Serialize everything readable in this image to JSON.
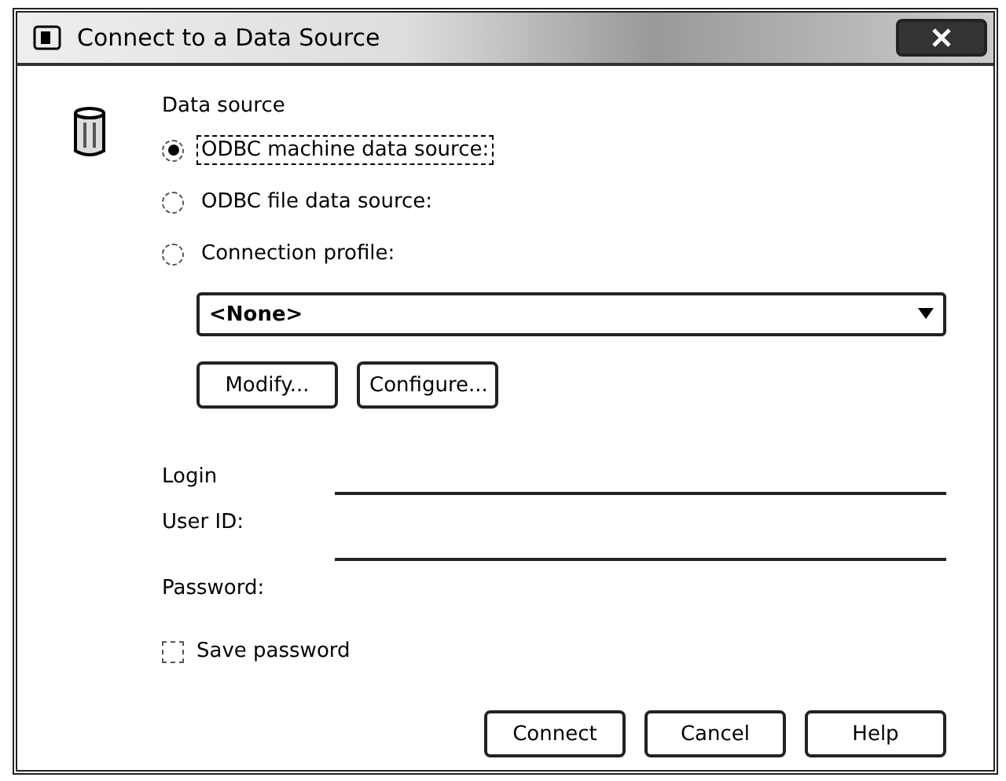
{
  "window": {
    "title": "Connect to a Data Source"
  },
  "data_source": {
    "heading": "Data source",
    "options": [
      {
        "label": "ODBC machine data source:",
        "selected": true
      },
      {
        "label": "ODBC file data source:",
        "selected": false
      },
      {
        "label": "Connection profile:",
        "selected": false
      }
    ],
    "profile": {
      "value": "<None>"
    },
    "buttons": [
      "Modify...",
      "Configure..."
    ]
  },
  "login": {
    "heading": "Login",
    "fields": [
      {
        "label": "User ID:"
      },
      {
        "label": "Password:"
      }
    ],
    "save_password": {
      "label": "Save password",
      "checked": false
    }
  },
  "buttons": [
    "Connect",
    "Cancel",
    "Help"
  ]
}
